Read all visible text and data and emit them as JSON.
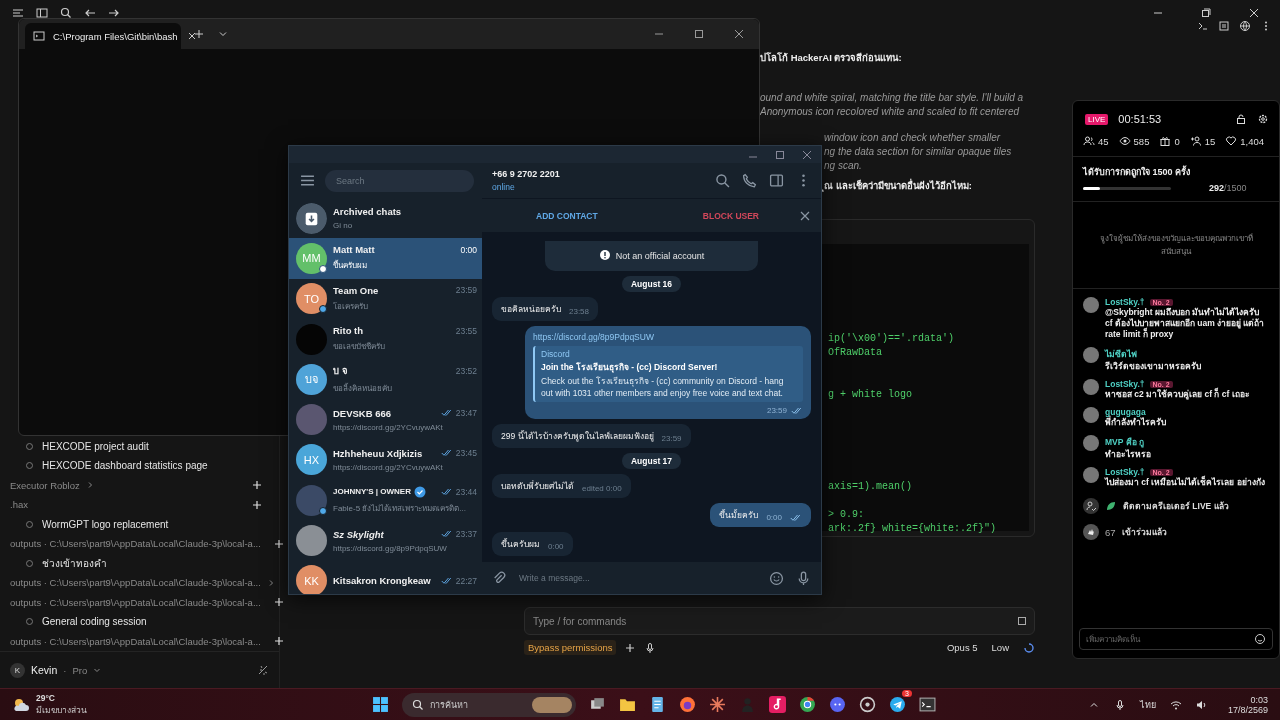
{
  "terminal": {
    "tab_title": "C:\\Program Files\\Git\\bin\\bash"
  },
  "sidebar": {
    "entries": [
      {
        "kind": "item",
        "label": "HEXCODE project audit"
      },
      {
        "kind": "item",
        "label": "HEXCODE dashboard statistics page"
      },
      {
        "kind": "group",
        "label": "Executor Robloz",
        "chevron": true
      },
      {
        "kind": "group",
        "label": ".hax",
        "chevron": false
      },
      {
        "kind": "item",
        "label": "WormGPT logo replacement"
      },
      {
        "kind": "group",
        "label": "outputs · C:\\Users\\part9\\AppData\\Local\\Claude-3p\\local-a...",
        "chevron": false
      },
      {
        "kind": "item",
        "label": "ช่วงเข้าทองคำ"
      },
      {
        "kind": "group",
        "label": "outputs · C:\\Users\\part9\\AppData\\Local\\Claude-3p\\local-a...",
        "chevron": true
      },
      {
        "kind": "group",
        "label": "outputs · C:\\Users\\part9\\AppData\\Local\\Claude-3p\\local-a...",
        "chevron": false
      },
      {
        "kind": "item",
        "label": "General coding session"
      },
      {
        "kind": "group",
        "label": "outputs · C:\\Users\\part9\\AppData\\Local\\Claude-3p\\local-a...",
        "chevron": false
      }
    ],
    "user": {
      "initial": "K",
      "name": "Kevin",
      "separator": "·",
      "plan": "Pro"
    }
  },
  "main": {
    "lines": [
      {
        "kind": "heading",
        "text": "ปโลโก้ HackerAI ตรวจสีก่อนแทน:"
      },
      {
        "kind": "thinking",
        "text": "ound and white spiral, matching the title bar style. I'll build a"
      },
      {
        "kind": "thinking",
        "text": " Anonymous icon recolored white and scaled to fit centered"
      },
      {
        "kind": "thinking",
        "text": "window icon and check whether smaller"
      },
      {
        "kind": "thinking",
        "text": "ng the data section for similar opaque tiles"
      },
      {
        "kind": "thinking",
        "text": "ng scan."
      },
      {
        "kind": "heading",
        "text": "ุณ และเช็คว่ามีขนาดอื่นฝังไว้อีกไหม:"
      }
    ],
    "code_groups": [
      [
        "ip('\\x00')=='.rdata')",
        "OfRawData"
      ],
      [
        "g + white logo"
      ],
      [
        "axis=1).mean()"
      ],
      [
        "> 0.9:",
        "ark:.2f} white={white:.2f}\")"
      ]
    ],
    "composer": {
      "placeholder": "Type / for commands",
      "mode": "Bypass permissions",
      "model": "Opus 5",
      "effort": "Low"
    }
  },
  "telegram": {
    "search_placeholder": "Search",
    "contact": {
      "name": "+66 9 2702 2201",
      "status": "online"
    },
    "actions": {
      "add": "ADD CONTACT",
      "block": "BLOCK USER"
    },
    "chats": [
      {
        "kind": "archive",
        "name": "Archived chats",
        "preview": "Gi no",
        "selected": false,
        "read": false,
        "online": false,
        "verified": false
      },
      {
        "kind": "initials",
        "initials": "MM",
        "color": "#63c06a",
        "name": "Matt Matt",
        "preview": "ขึ้นครับผม",
        "time": "0:00",
        "selected": true,
        "read": false,
        "online": true,
        "verified": false
      },
      {
        "kind": "initials",
        "initials": "TO",
        "color": "#e08e65",
        "name": "Team One",
        "preview": "โอเครครับ",
        "time": "23:59",
        "selected": false,
        "read": false,
        "online": true,
        "verified": false
      },
      {
        "kind": "photo",
        "color": "#050505",
        "name": "Rito th",
        "preview": "ขอเลขบัชชีครับ",
        "time": "23:55",
        "selected": false,
        "read": false,
        "online": false,
        "verified": false
      },
      {
        "kind": "initials",
        "initials": "บจ",
        "color": "#4fa3d8",
        "name": "บ จ",
        "preview": "ขอลิ้งคิลหน่อยคับ",
        "time": "23:52",
        "selected": false,
        "read": false,
        "online": false,
        "verified": false
      },
      {
        "kind": "photo",
        "color": "#5a5670",
        "name": "DEVSKB 666",
        "preview": "https://discord.gg/2YCvuywAKt",
        "time": "23:47",
        "selected": false,
        "read": true,
        "online": false,
        "verified": false
      },
      {
        "kind": "initials",
        "initials": "HX",
        "color": "#4aa6d9",
        "name": "Hzhheheuu Xdjkizis",
        "preview": "https://discord.gg/2YCvuywAKt",
        "time": "23:45",
        "selected": false,
        "read": true,
        "online": false,
        "verified": false
      },
      {
        "kind": "photo",
        "color": "#3b4a66",
        "name": "JOHNNY'S | OWNER",
        "preview": "Fable-5 ยังไม่ได้เทสเพราะหมดเครดิต...",
        "time": "23:44",
        "selected": false,
        "read": true,
        "online": true,
        "verified": true
      },
      {
        "kind": "photo",
        "color": "#8a8f95",
        "name": "Sz Skylight",
        "preview": "https://discord.gg/8p9PdpqSUW",
        "time": "23:37",
        "selected": false,
        "read": true,
        "online": false,
        "verified": false
      },
      {
        "kind": "initials",
        "initials": "KK",
        "color": "#e08e65",
        "name": "Kitsakron Krongkeaw",
        "time": "22:27",
        "selected": false,
        "read": true,
        "online": false,
        "verified": false
      }
    ],
    "notice": "Not an official account",
    "messages": [
      {
        "kind": "date",
        "text": "August 16"
      },
      {
        "kind": "in",
        "text": "ขอคิลหน่อยครับ",
        "time": "23:58"
      },
      {
        "kind": "link",
        "url": "https://discord.gg/8p9PdpqSUW",
        "site": "Discord",
        "title": "Join the **โรงเรียนธุรกิจ** - (cc) Discord Server!",
        "desc": "Check out the โรงเรียนธุรกิจ - (cc) community on Discord - hang out with 1031 other members and enjoy free voice and text chat.",
        "time": "23:59",
        "read": true
      },
      {
        "kind": "in",
        "text": "299 นี้ได้ไรบ้างครับพูดในไลฟ์เลยผมฟังอยู่",
        "time": "23:59"
      },
      {
        "kind": "date",
        "text": "August 17"
      },
      {
        "kind": "in",
        "text": "บอทดับพี่รับยศไม่ได้",
        "time": "edited 0:00"
      },
      {
        "kind": "out",
        "text": "ขึ้นมั้ยครับ",
        "time": "0:00",
        "read": true
      },
      {
        "kind": "in",
        "text": "ขึ้นครับผม",
        "time": "0:00"
      }
    ],
    "composer_placeholder": "Write a message..."
  },
  "live": {
    "badge": "LIVE",
    "timer": "00:51:53",
    "stats": [
      {
        "kind": "people",
        "value": "45"
      },
      {
        "kind": "eye",
        "value": "585"
      },
      {
        "kind": "gift",
        "value": "0"
      },
      {
        "kind": "follow",
        "value": "15"
      },
      {
        "kind": "heart",
        "value": "1,404"
      }
    ],
    "goal": {
      "title": "ได้รับการกดถูกใจ 1500 ครั้ง",
      "current": "292",
      "target": "/1500",
      "level": 0.195
    },
    "prompt": "จูงใจผู้ชมให้ส่งของขวัญและขอบคุณพวกเขาที่สนับสนุน",
    "comments": [
      {
        "name": "LostSky.†",
        "badge": "No. 2",
        "text": "@Skybright ผมถึงบอก มันทำไม่ได้ไงครับ cf ต้องไปบายพาสแยกอีก uam ง่ายอยู่ แต่ถ้า rate limit ก็ proxy"
      },
      {
        "name": "ไม่ซีดไฟ",
        "text": "รีเวิร์ดของเขามาหรอครับ"
      },
      {
        "name": "LostSky.†",
        "badge": "No. 2",
        "text": "หาซอส c2 มาใช้ควบคู่เลย cf ก็ cf เถอะ"
      },
      {
        "name": "gugugaga",
        "text": "พี่กำลังทำไรครับ"
      },
      {
        "name": "MVP คือ กู",
        "text": "ทำอะไรหรอ"
      },
      {
        "name": "LostSky.†",
        "badge": "No. 2",
        "text": "ไปส่องมา cf เหมือนไม่ได้เช็คไรเลย อย่างกัง"
      }
    ],
    "events": [
      {
        "kind": "follow",
        "text": "ติดตามครีเอเตอร์ LIVE แล้ว"
      },
      {
        "kind": "join",
        "count": "67",
        "text": "เข้าร่วมแล้ว"
      }
    ],
    "input_placeholder": "เพิ่มความคิดเห็น"
  },
  "taskbar": {
    "temperature": "29°C",
    "weather": "มีเมฆบางส่วน",
    "search": "การค้นหา",
    "language": "ไทย",
    "time": "0:03",
    "date": "17/8/2569",
    "telegram_badge": "3"
  }
}
